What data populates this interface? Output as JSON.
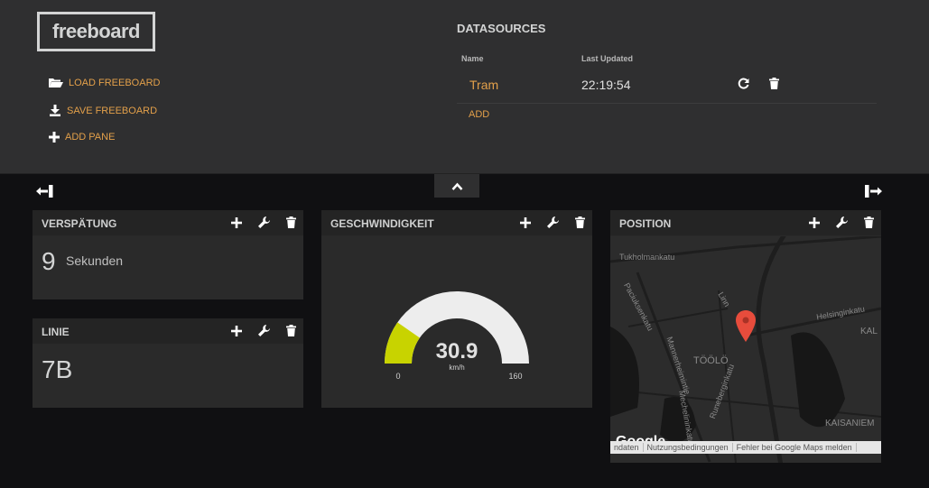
{
  "header": {
    "logo": "freeboard",
    "actions": {
      "load": "LOAD FREEBOARD",
      "save": "SAVE FREEBOARD",
      "add_pane": "ADD PANE"
    },
    "datasources": {
      "title": "DATASOURCES",
      "col_name": "Name",
      "col_updated": "Last Updated",
      "rows": [
        {
          "name": "Tram",
          "updated": "22:19:54"
        }
      ],
      "add_label": "ADD"
    }
  },
  "panes": {
    "verspaetung": {
      "title": "VERSPÄTUNG",
      "value": "9",
      "units": "Sekunden"
    },
    "linie": {
      "title": "LINIE",
      "value": "7B"
    },
    "geschwindigkeit": {
      "title": "GESCHWINDIGKEIT",
      "gauge": {
        "value": "30.9",
        "units": "km/h",
        "min": "0",
        "max": "160",
        "fill_fraction": 0.193
      }
    },
    "position": {
      "title": "POSITION",
      "map_labels": {
        "tukholmankatu": "Tukholmankatu",
        "paciuksenkatu": "Paciuksenkatu",
        "helsinginkatu": "Helsinginkatu",
        "toolo": "TÖÖLÖ",
        "kaisaniemi": "KAISANIEM",
        "kal": "KAL",
        "mannerheimintie": "Mannerheimintie",
        "runeberginkatu": "Runeberginkatu",
        "linn": "Linn",
        "mech": "Mechelininkatu"
      },
      "google": "Google",
      "footer": [
        "ndaten",
        "Nutzungsbedingungen",
        "Fehler bei Google Maps melden"
      ]
    }
  },
  "colors": {
    "accent": "#e3a04a",
    "gauge_fill": "#c8d300",
    "gauge_bg": "#ededed",
    "marker": "#e74c3c"
  }
}
